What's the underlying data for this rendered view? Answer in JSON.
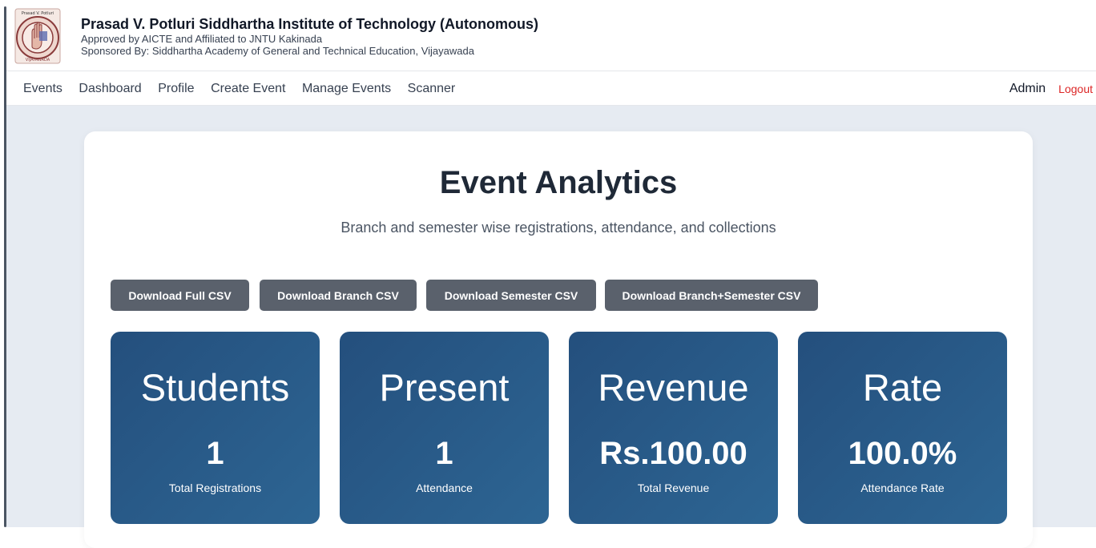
{
  "header": {
    "logo_icon": "institute-seal-icon",
    "logo_text_top": "Prasad V. Potluri",
    "logo_text_bottom": "VIJAYAWADA",
    "institute_name": "Prasad V. Potluri Siddhartha Institute of Technology (Autonomous)",
    "line1": "Approved by AICTE and Affiliated to JNTU Kakinada",
    "line2": "Sponsored By: Siddhartha Academy of General and Technical Education, Vijayawada"
  },
  "nav": {
    "items": [
      {
        "label": "Events"
      },
      {
        "label": "Dashboard"
      },
      {
        "label": "Profile"
      },
      {
        "label": "Create Event"
      },
      {
        "label": "Manage Events"
      },
      {
        "label": "Scanner"
      }
    ],
    "user_label": "Admin",
    "logout_label": "Logout"
  },
  "page": {
    "title": "Event Analytics",
    "subtitle": "Branch and semester wise registrations, attendance, and collections"
  },
  "downloads": [
    {
      "label": "Download Full CSV"
    },
    {
      "label": "Download Branch CSV"
    },
    {
      "label": "Download Semester CSV"
    },
    {
      "label": "Download Branch+Semester CSV"
    }
  ],
  "stats": [
    {
      "title": "Students",
      "value": "1",
      "label": "Total Registrations"
    },
    {
      "title": "Present",
      "value": "1",
      "label": "Attendance"
    },
    {
      "title": "Revenue",
      "value": "Rs.100.00",
      "label": "Total Revenue"
    },
    {
      "title": "Rate",
      "value": "100.0%",
      "label": "Attendance Rate"
    }
  ],
  "colors": {
    "stat_card_start": "#244f7d",
    "stat_card_end": "#2d6593",
    "button_bg": "#5a616c",
    "logout": "#dc2626",
    "page_bg": "#e6ebf2"
  }
}
